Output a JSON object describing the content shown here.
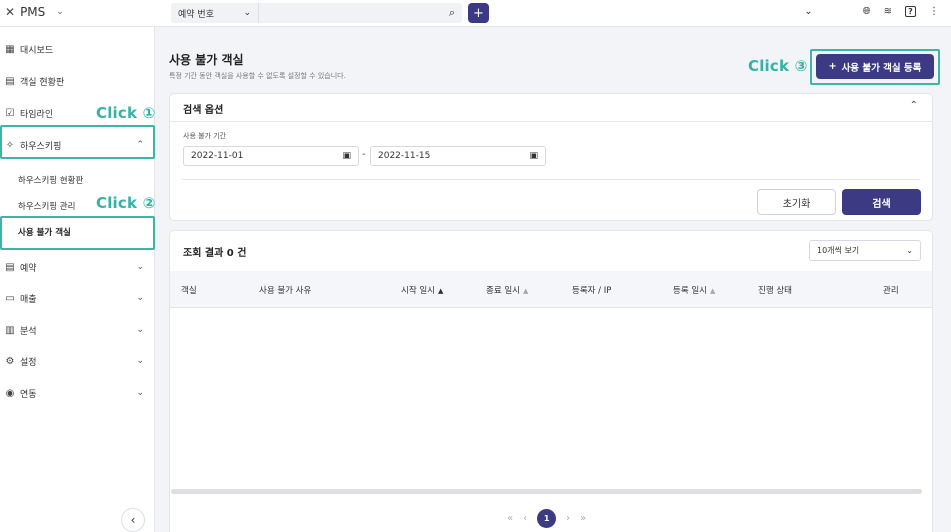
{
  "header": {
    "app_name": "PMS",
    "search_type": "예약 번호",
    "search_value": "",
    "search_placeholder": ""
  },
  "sidebar": {
    "items": [
      {
        "label": "대시보드",
        "icon": "dashboard-icon"
      },
      {
        "label": "객실 현황판",
        "icon": "calendar-icon"
      },
      {
        "label": "타임라인",
        "icon": "timeline-icon"
      },
      {
        "label": "하우스키핑",
        "icon": "sparkle-icon",
        "expanded": true
      },
      {
        "label": "예약",
        "icon": "calendar-icon"
      },
      {
        "label": "매출",
        "icon": "receipt-icon"
      },
      {
        "label": "분석",
        "icon": "bar-chart-icon"
      },
      {
        "label": "설정",
        "icon": "gear-icon"
      },
      {
        "label": "연동",
        "icon": "link-icon"
      }
    ],
    "housekeeping_sub": [
      "하우스키핑 현황판",
      "하우스키핑 관리",
      "사용 불가 객실"
    ]
  },
  "annotations": {
    "click1": "Click ①",
    "click2": "Click ②",
    "click3": "Click ③"
  },
  "page": {
    "title": "사용 불가 객실",
    "subtitle": "특정 기간 동안 객실을 사용할 수 없도록 설정할 수 있습니다.",
    "register_button": "사용 불가 객실 등록"
  },
  "search_options": {
    "title": "검색 옵션",
    "period_label": "사용 불가 기간",
    "start_date": "2022-11-01",
    "end_date": "2022-11-15",
    "separator": "-",
    "reset_button": "초기화",
    "search_button": "검색"
  },
  "results": {
    "title": "조회 결과 0 건",
    "page_size": "10개씩 보기",
    "columns": [
      "객실",
      "사용 불가 사유",
      "시작 일시",
      "종료 일시",
      "등록자 / IP",
      "등록 일시",
      "진행 상태",
      "관리"
    ]
  },
  "pagination": {
    "current": "1"
  },
  "colors": {
    "primary": "#3d3a84",
    "annotation": "#3ab5a8"
  }
}
